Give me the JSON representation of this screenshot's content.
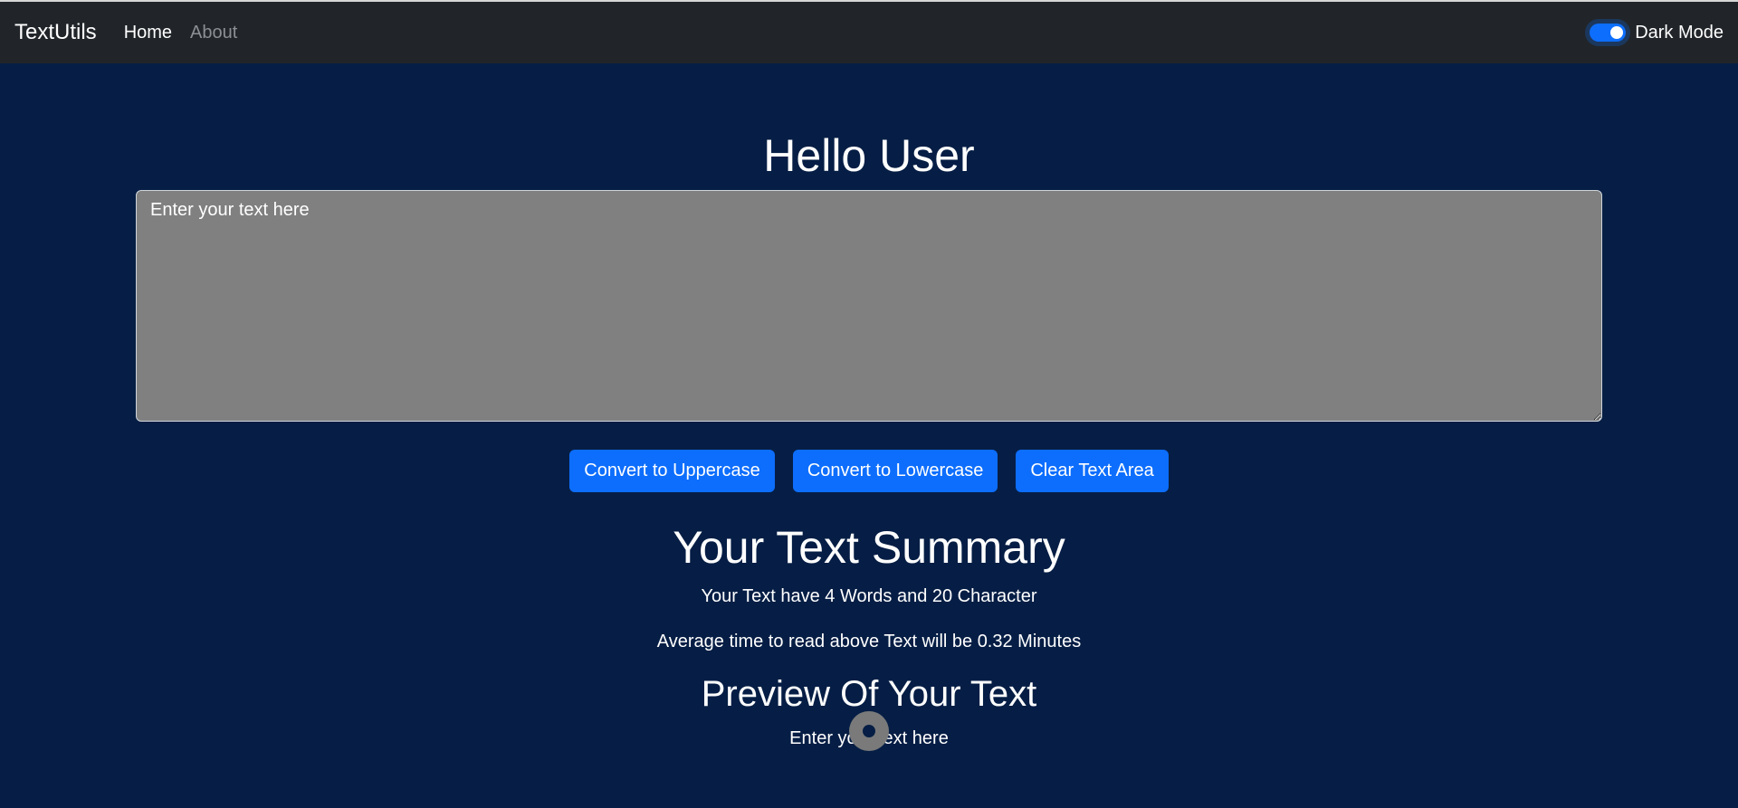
{
  "navbar": {
    "brand": "TextUtils",
    "links": [
      {
        "label": "Home",
        "active": true
      },
      {
        "label": "About",
        "active": false
      }
    ],
    "dark_mode_label": "Dark Mode",
    "dark_mode_on": true
  },
  "main": {
    "heading": "Hello User",
    "textarea_value": "Enter your text here",
    "buttons": {
      "uppercase": "Convert to Uppercase",
      "lowercase": "Convert to Lowercase",
      "clear": "Clear Text Area"
    },
    "summary_heading": "Your Text Summary",
    "summary_counts": "Your Text have 4 Words and 20 Character",
    "read_time": "Average time to read above Text will be 0.32 Minutes",
    "preview_heading": "Preview Of Your Text",
    "preview_text": "Enter your text here"
  },
  "colors": {
    "navbar": "#212529",
    "background": "#061e45",
    "accent": "#0d6efd",
    "textarea": "#808080"
  }
}
